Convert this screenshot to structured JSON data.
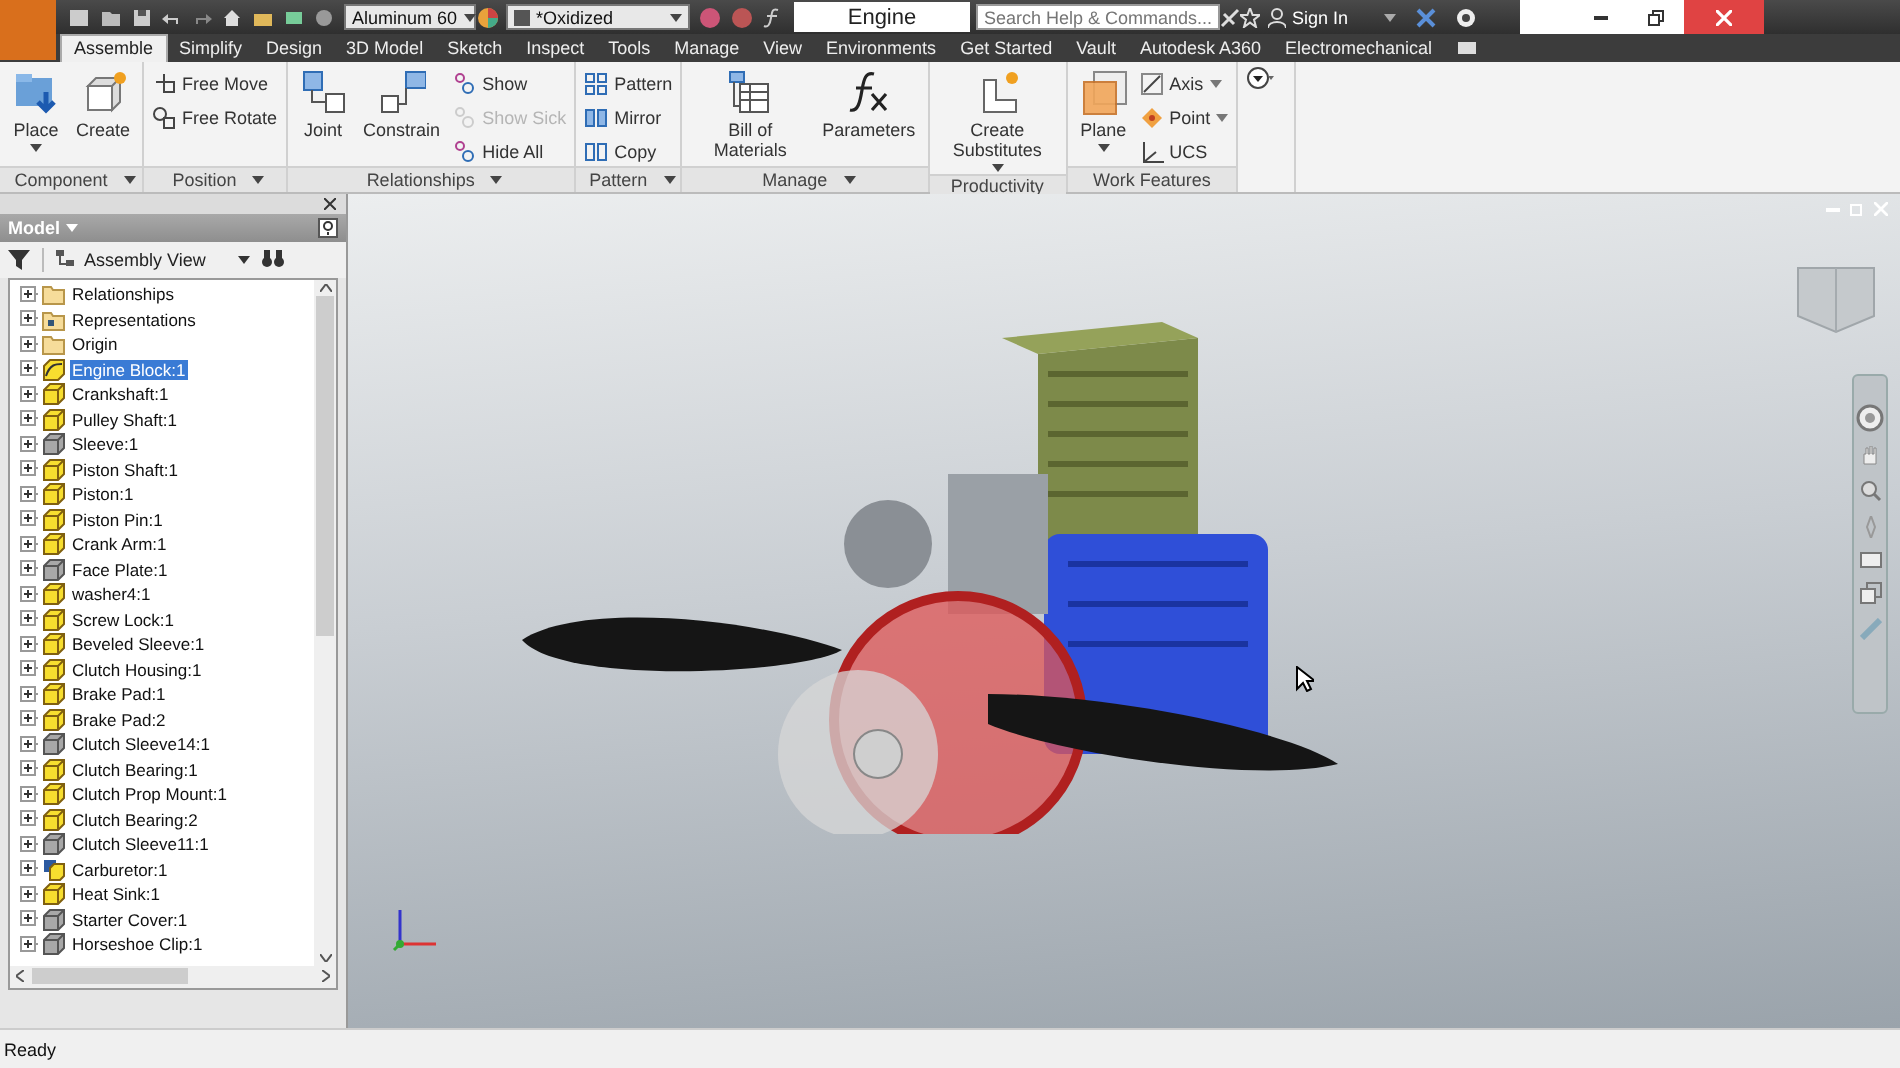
{
  "title_bar": {
    "material": "Aluminum 60",
    "appearance": "*Oxidized",
    "document_title": "Engine",
    "search": {
      "placeholder": "Search Help & Commands..."
    },
    "sign_in": "Sign In"
  },
  "tabs": [
    {
      "label": "Assemble",
      "selected": true
    },
    {
      "label": "Simplify",
      "selected": false
    },
    {
      "label": "Design",
      "selected": false
    },
    {
      "label": "3D Model",
      "selected": false
    },
    {
      "label": "Sketch",
      "selected": false
    },
    {
      "label": "Inspect",
      "selected": false
    },
    {
      "label": "Tools",
      "selected": false
    },
    {
      "label": "Manage",
      "selected": false
    },
    {
      "label": "View",
      "selected": false
    },
    {
      "label": "Environments",
      "selected": false
    },
    {
      "label": "Get Started",
      "selected": false
    },
    {
      "label": "Vault",
      "selected": false
    },
    {
      "label": "Autodesk A360",
      "selected": false
    },
    {
      "label": "Electromechanical",
      "selected": false
    }
  ],
  "ribbon": {
    "panels": [
      {
        "title": "Component",
        "menu": true,
        "buttons": [
          {
            "kind": "large",
            "label": "Place",
            "dropdown": true,
            "disabled": false
          },
          {
            "kind": "large",
            "label": "Create",
            "dropdown": false,
            "disabled": false
          }
        ]
      },
      {
        "title": "Position",
        "menu": true,
        "buttons": [
          {
            "kind": "small",
            "label": "Free Move",
            "dropdown": false,
            "disabled": false
          },
          {
            "kind": "small",
            "label": "Free Rotate",
            "dropdown": false,
            "disabled": false
          }
        ]
      },
      {
        "title": "Relationships",
        "menu": true,
        "buttons": [
          {
            "kind": "large",
            "label": "Joint",
            "dropdown": false,
            "disabled": false
          },
          {
            "kind": "large",
            "label": "Constrain",
            "dropdown": false,
            "disabled": false
          },
          {
            "kind": "small",
            "label": "Show",
            "dropdown": false,
            "disabled": false
          },
          {
            "kind": "small",
            "label": "Show Sick",
            "dropdown": false,
            "disabled": true
          },
          {
            "kind": "small",
            "label": "Hide All",
            "dropdown": false,
            "disabled": false
          }
        ]
      },
      {
        "title": "Pattern",
        "menu": true,
        "buttons": [
          {
            "kind": "small",
            "label": "Pattern",
            "dropdown": false,
            "disabled": false
          },
          {
            "kind": "small",
            "label": "Mirror",
            "dropdown": false,
            "disabled": false
          },
          {
            "kind": "small",
            "label": "Copy",
            "dropdown": false,
            "disabled": false
          }
        ]
      },
      {
        "title": "Manage",
        "menu": true,
        "buttons": [
          {
            "kind": "large",
            "label": "Bill of Materials",
            "dropdown": false,
            "disabled": false
          },
          {
            "kind": "large",
            "label": "Parameters",
            "dropdown": false,
            "disabled": false
          }
        ]
      },
      {
        "title": "Productivity",
        "menu": false,
        "buttons": [
          {
            "kind": "large",
            "label": "Create Substitutes",
            "dropdown": true,
            "disabled": false
          }
        ]
      },
      {
        "title": "Work Features",
        "menu": false,
        "buttons": [
          {
            "kind": "large",
            "label": "Plane",
            "dropdown": true,
            "disabled": false
          },
          {
            "kind": "small",
            "label": "Axis",
            "dropdown": true,
            "disabled": false
          },
          {
            "kind": "small",
            "label": "Point",
            "dropdown": true,
            "disabled": false
          },
          {
            "kind": "small",
            "label": "UCS",
            "dropdown": false,
            "disabled": false
          }
        ]
      }
    ]
  },
  "browser": {
    "title": "Model",
    "view": "Assembly View",
    "items": [
      {
        "label": "Relationships",
        "kind": "folder",
        "selected": false
      },
      {
        "label": "Representations",
        "kind": "representations",
        "selected": false
      },
      {
        "label": "Origin",
        "kind": "folder",
        "selected": false
      },
      {
        "label": "Engine Block:1",
        "kind": "adaptive",
        "selected": true
      },
      {
        "label": "Crankshaft:1",
        "kind": "part",
        "selected": false
      },
      {
        "label": "Pulley Shaft:1",
        "kind": "part",
        "selected": false
      },
      {
        "label": "Sleeve:1",
        "kind": "library",
        "selected": false
      },
      {
        "label": "Piston Shaft:1",
        "kind": "part",
        "selected": false
      },
      {
        "label": "Piston:1",
        "kind": "part",
        "selected": false
      },
      {
        "label": "Piston Pin:1",
        "kind": "part",
        "selected": false
      },
      {
        "label": "Crank Arm:1",
        "kind": "part",
        "selected": false
      },
      {
        "label": "Face Plate:1",
        "kind": "library",
        "selected": false
      },
      {
        "label": "washer4:1",
        "kind": "part",
        "selected": false
      },
      {
        "label": "Screw Lock:1",
        "kind": "part",
        "selected": false
      },
      {
        "label": "Beveled Sleeve:1",
        "kind": "part",
        "selected": false
      },
      {
        "label": "Clutch Housing:1",
        "kind": "part",
        "selected": false
      },
      {
        "label": "Brake Pad:1",
        "kind": "part",
        "selected": false
      },
      {
        "label": "Brake Pad:2",
        "kind": "part",
        "selected": false
      },
      {
        "label": "Clutch Sleeve14:1",
        "kind": "library",
        "selected": false
      },
      {
        "label": "Clutch Bearing:1",
        "kind": "part",
        "selected": false
      },
      {
        "label": "Clutch Prop Mount:1",
        "kind": "part",
        "selected": false
      },
      {
        "label": "Clutch Bearing:2",
        "kind": "part",
        "selected": false
      },
      {
        "label": "Clutch Sleeve11:1",
        "kind": "library",
        "selected": false
      },
      {
        "label": "Carburetor:1",
        "kind": "assembly",
        "selected": false
      },
      {
        "label": "Heat Sink:1",
        "kind": "part",
        "selected": false
      },
      {
        "label": "Starter Cover:1",
        "kind": "library",
        "selected": false
      },
      {
        "label": "Horseshoe Clip:1",
        "kind": "library",
        "selected": false
      }
    ]
  },
  "status_bar": {
    "text": "Ready"
  }
}
